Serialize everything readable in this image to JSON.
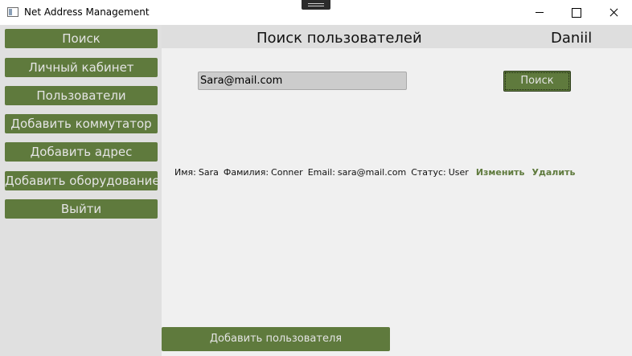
{
  "window": {
    "title": "Net Address Management"
  },
  "sidebar": {
    "items": [
      {
        "label": "Поиск"
      },
      {
        "label": "Личный кабинет"
      },
      {
        "label": "Пользователи"
      },
      {
        "label": "Добавить коммутатор"
      },
      {
        "label": "Добавить адрес"
      },
      {
        "label": "Добавить оборудование"
      },
      {
        "label": "Выйти"
      }
    ]
  },
  "header": {
    "title": "Поиск пользователей",
    "username": "Daniil"
  },
  "search": {
    "value": "Sara@mail.com",
    "button_label": "Поиск"
  },
  "result": {
    "first_name_label": "Имя:",
    "first_name": "Sara",
    "last_name_label": "Фамилия:",
    "last_name": "Conner",
    "email_label": "Email:",
    "email": "sara@mail.com",
    "status_label": "Статус:",
    "status": "User",
    "edit_label": "Изменить",
    "delete_label": "Удалить"
  },
  "footer": {
    "add_user_label": "Добавить пользователя"
  },
  "colors": {
    "accent": "#5f7a3d",
    "sidebar_bg": "#e0e0e0",
    "content_bg": "#f0f0f0"
  },
  "icons": {
    "app": "window-app-icon",
    "minimize": "minimize-icon",
    "maximize": "maximize-icon",
    "close": "close-icon"
  }
}
